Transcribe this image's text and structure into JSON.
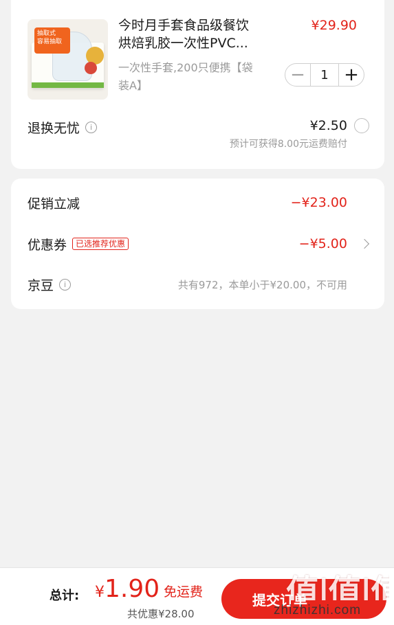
{
  "product": {
    "title_line1": "今时月手套食品级餐饮",
    "title_line2": "烘焙乳胶一次性PVC...",
    "price": "¥29.90",
    "spec_line1": "一次性手套,200只便携【袋",
    "spec_line2": "装A】",
    "quantity": "1",
    "thumb_ribbon_line1": "抽取式",
    "thumb_ribbon_line2": "容易抽取"
  },
  "service": {
    "label": "退换无忧",
    "price": "¥2.50",
    "note": "预计可获得8.00元运费赔付",
    "selected": false
  },
  "promotions": {
    "promo_label": "促销立减",
    "promo_value": "−¥23.00",
    "coupon_label": "优惠券",
    "coupon_tag": "已选推荐优惠",
    "coupon_value": "−¥5.00",
    "jingdou_label": "京豆",
    "jingdou_value": "共有972，本单小于¥20.00，不可用"
  },
  "footer": {
    "total_label": "总计:",
    "currency": "¥",
    "total_value": "1.90",
    "free_shipping": "免运费",
    "discount": "共优惠¥28.00",
    "submit_label": "提交订单"
  },
  "watermark": {
    "logo": "值|值|值",
    "text": "zhizhizhi.com"
  },
  "colors": {
    "accent": "#e2231a",
    "button": "#e8261d",
    "background": "#f2f2f2"
  }
}
